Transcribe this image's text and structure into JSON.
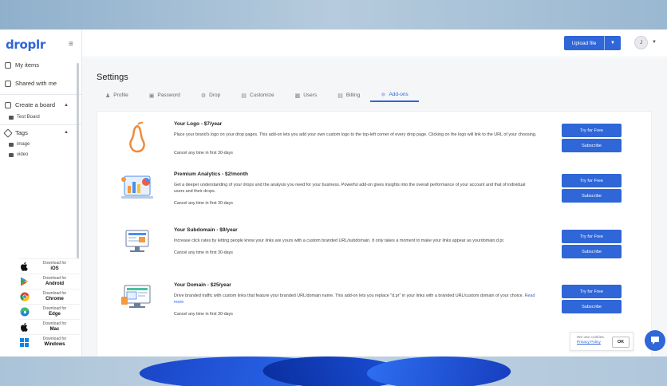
{
  "app": {
    "logo": "droplr",
    "brand_color": "#2f66d8"
  },
  "sidebar": {
    "my_items": "My items",
    "shared": "Shared with me",
    "create_board": "Create a board",
    "boards": [
      "Test Board"
    ],
    "tags_label": "Tags",
    "tags": [
      "image",
      "video"
    ],
    "downloads": [
      {
        "top": "Download for",
        "name": "iOS",
        "icon": "apple-icon"
      },
      {
        "top": "Download for",
        "name": "Android",
        "icon": "google-play-icon"
      },
      {
        "top": "Download for",
        "name": "Chrome",
        "icon": "chrome-icon"
      },
      {
        "top": "Download for",
        "name": "Edge",
        "icon": "edge-icon"
      },
      {
        "top": "Download for",
        "name": "Mac",
        "icon": "apple-icon"
      },
      {
        "top": "Download for",
        "name": "Windows",
        "icon": "windows-icon"
      }
    ]
  },
  "header": {
    "upload_label": "Upload file",
    "avatar_initial": "J"
  },
  "settings": {
    "title": "Settings",
    "tabs": [
      {
        "label": "Profile",
        "icon": "person-icon"
      },
      {
        "label": "Password",
        "icon": "lock-icon"
      },
      {
        "label": "Drop",
        "icon": "gear-icon"
      },
      {
        "label": "Customize",
        "icon": "customize-icon"
      },
      {
        "label": "Users",
        "icon": "users-icon"
      },
      {
        "label": "Billing",
        "icon": "billing-icon"
      },
      {
        "label": "Add-ons",
        "icon": "addons-icon",
        "active": true
      }
    ]
  },
  "addons": [
    {
      "name": "Your Logo - $7/year",
      "desc": "Place your brand's logo on your drop pages. This add-on lets you add your own custom logo to the top-left corner of every drop page. Clicking on the logo will link to the URL of your choosing.",
      "read_more": "",
      "cancel": "Cancel any time in first 30-days",
      "try": "Try for Free",
      "subscribe": "Subscribe",
      "icon": "pear-logo-icon"
    },
    {
      "name": "Premium Analytics - $2/month",
      "desc": "Get a deeper understanding of your drops and the analysis you need for your business. Powerful add-on gives insights into the overall performance of your account and that of individual users and their drops.",
      "read_more": "",
      "cancel": "Cancel any time in first 30-days",
      "try": "Try for Free",
      "subscribe": "Subscribe",
      "icon": "analytics-illustration-icon"
    },
    {
      "name": "Your Subdomain - $9/year",
      "desc": "Increase click rates by letting people know your links are yours with a custom branded URL/subdomain. It only takes a moment to make your links appear as yourdomain.d.pr.",
      "read_more": "",
      "cancel": "Cancel any time in first 30-days",
      "try": "Try for Free",
      "subscribe": "Subscribe",
      "icon": "subdomain-illustration-icon"
    },
    {
      "name": "Your Domain - $25/year",
      "desc": "Drive branded traffic with custom links that feature your branded URL/domain name. This add-on lets you replace \"d.pr\" in your links with a branded URL/custom domain of your choice.",
      "read_more": "Read more",
      "cancel": "Cancel any time in first 30-days",
      "try": "Try for Free",
      "subscribe": "Subscribe",
      "icon": "domain-illustration-icon"
    }
  ],
  "cookie": {
    "text": "We use cookies.",
    "policy": "Privacy Policy",
    "ok": "OK"
  }
}
